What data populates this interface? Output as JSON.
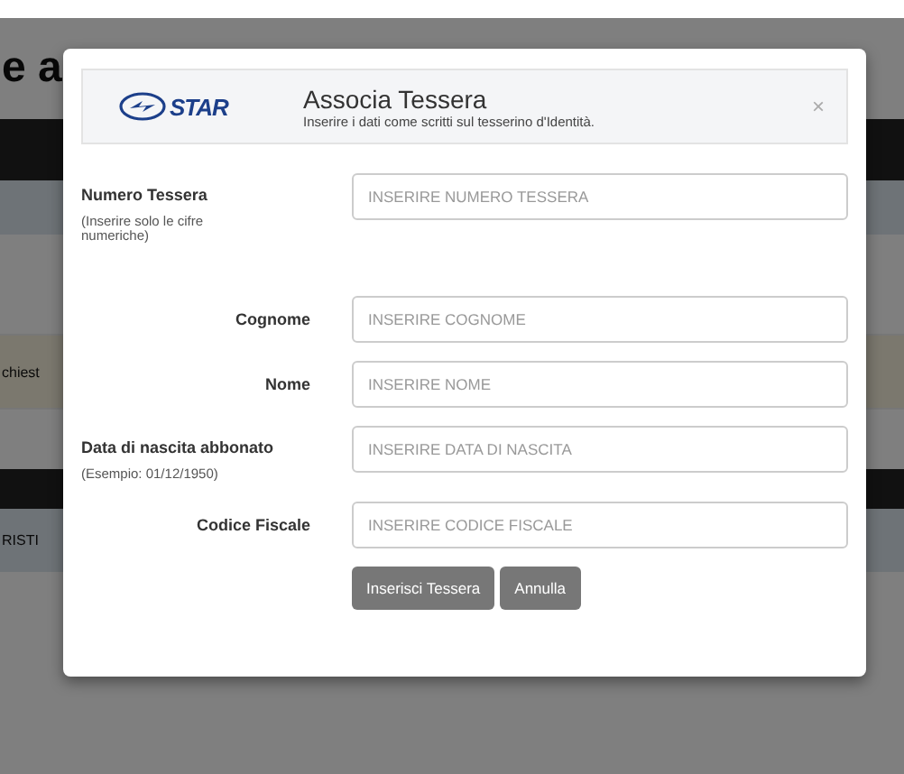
{
  "background": {
    "heading": "e a",
    "fragments": [
      "chiest",
      "RISTI"
    ]
  },
  "dialog": {
    "logo": "STAR",
    "title": "Associa Tessera",
    "subtitle": "Inserire i dati come scritti sul tesserino d'Identità.",
    "close": "×",
    "fields": [
      {
        "kind": "stacked",
        "label": "Numero Tessera",
        "hint": "(Inserire solo le cifre numeriche)",
        "placeholder": "INSERIRE NUMERO TESSERA"
      },
      {
        "kind": "inline",
        "label": "Cognome",
        "placeholder": "INSERIRE COGNOME"
      },
      {
        "kind": "inline",
        "label": "Nome",
        "placeholder": "INSERIRE NOME"
      },
      {
        "kind": "stacked",
        "label": "Data di nascita abbonato",
        "hint": "(Esempio: 01/12/1950)",
        "placeholder": "INSERIRE DATA DI NASCITA"
      },
      {
        "kind": "inline",
        "label": "Codice Fiscale",
        "placeholder": "INSERIRE CODICE FISCALE"
      }
    ],
    "buttons": [
      "Inserisci Tessera",
      "Annulla"
    ]
  }
}
